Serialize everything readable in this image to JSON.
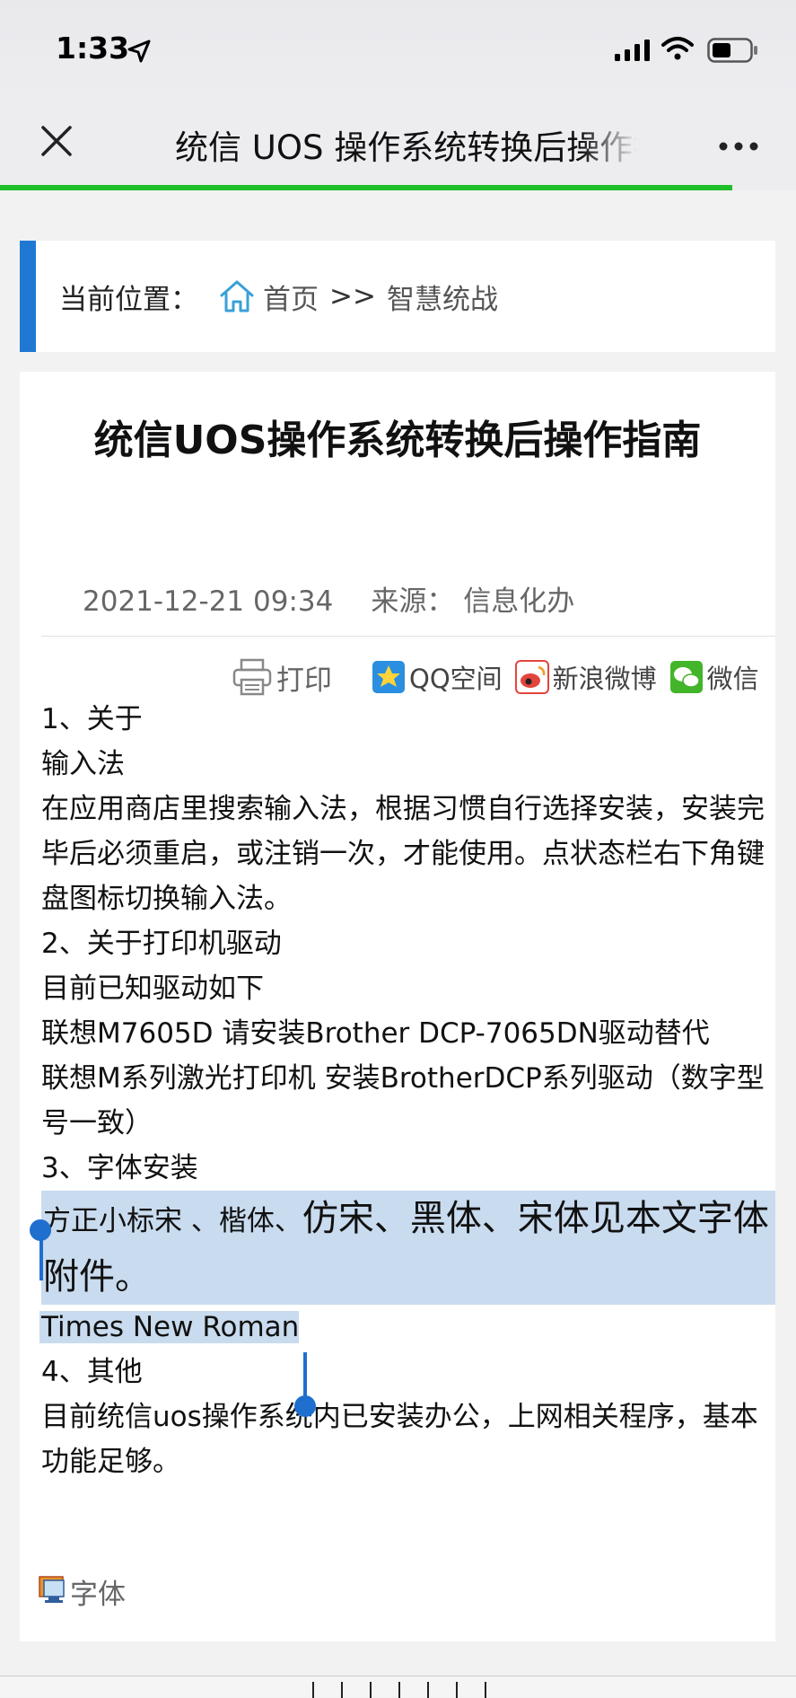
{
  "status_bar": {
    "time": "1:33",
    "icons": [
      "location-arrow-icon",
      "cellular-signal-icon",
      "wifi-icon",
      "battery-icon"
    ]
  },
  "nav_bar": {
    "title": "统信 UOS 操作系统转换后操作指南",
    "close_icon": "close-icon",
    "more_icon": "more-icon",
    "load_progress": 0.92,
    "progress_color": "#1fbf29"
  },
  "breadcrumb": {
    "label": "当前位置：",
    "home": "首页",
    "separator": ">>",
    "section": "智慧统战",
    "accent_color": "#1f79d4"
  },
  "article": {
    "title": "统信UOS操作系统转换后操作指南",
    "date": "2021-12-21 09:34",
    "source_label": "来源：",
    "source": "信息化办",
    "share": {
      "print": "打印",
      "qzone": "QQ空间",
      "weibo": "新浪微博",
      "wechat": "微信"
    },
    "paragraphs": {
      "p1": "1、关于",
      "p2": "输入法",
      "p3": "在应用商店里搜索输入法，根据习惯自行选择安装，安装完毕后必须重启，或注销一次，才能使用。点状态栏右下角键盘图标切换输入法。",
      "p4": "2、关于打印机驱动",
      "p5": "目前已知驱动如下",
      "p6": "联想M7605D  请安装Brother DCP-7065DN驱动替代",
      "p7": "联想M系列激光打印机  安装BrotherDCP系列驱动（数字型号一致）",
      "p8": "3、字体安装",
      "p9_small": "方正小标宋 、楷体、",
      "p9_large": "仿宋、黑体、宋体见本文字体附件。",
      "p10": "Times New Roman",
      "p11": "4、其他",
      "p12": "目前统信uos操作系统内已安装办公，上网相关程序，基本功能足够。"
    },
    "attachment": "字体",
    "selection_color": "#c9dbee"
  }
}
